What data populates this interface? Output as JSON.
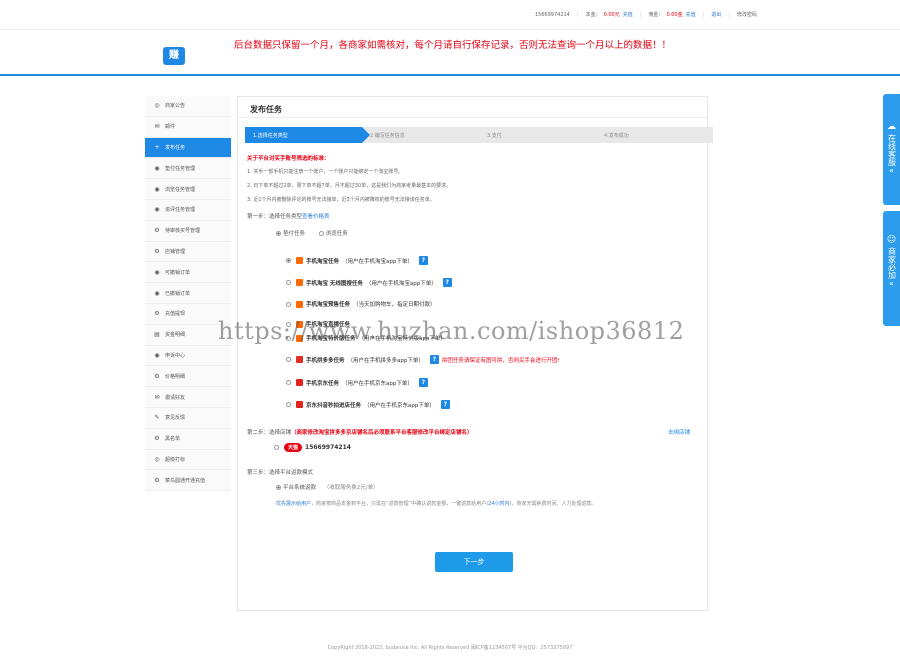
{
  "topbar": {
    "user": "15669974214",
    "capital_label": "本金：",
    "capital_value": "0.00元",
    "recharge": "充值",
    "commission_label": "佣金：",
    "commission_value": "0.00金",
    "recharge2": "充值",
    "logout": "退出",
    "change_password": "修改密码"
  },
  "header": {
    "logo_text": "赚",
    "notice": "后台数据只保留一个月，各商家如需核对，每个月请自行保存记录，否则无法查询一个月以上的数据！！"
  },
  "sidebar": {
    "items": [
      {
        "icon": "◎",
        "label": "商家公告"
      },
      {
        "icon": "✉",
        "label": "邮件"
      },
      {
        "icon": "+",
        "label": "发布任务"
      },
      {
        "icon": "◉",
        "label": "垫付任务管理"
      },
      {
        "icon": "◉",
        "label": "浏览任务管理"
      },
      {
        "icon": "◉",
        "label": "追评任务管理"
      },
      {
        "icon": "⚙",
        "label": "待审核买号管理"
      },
      {
        "icon": "⚙",
        "label": "店铺管理"
      },
      {
        "icon": "◉",
        "label": "可撤销订单"
      },
      {
        "icon": "◉",
        "label": "已撤销订单"
      },
      {
        "icon": "⚙",
        "label": "充值提现"
      },
      {
        "icon": "▤",
        "label": "资金明细"
      },
      {
        "icon": "◉",
        "label": "申诉中心"
      },
      {
        "icon": "⚙",
        "label": "价格明细"
      },
      {
        "icon": "✉",
        "label": "邀请好友"
      },
      {
        "icon": "✎",
        "label": "意见反馈"
      },
      {
        "icon": "⚙",
        "label": "黑名单"
      },
      {
        "icon": "◎",
        "label": "超级打标"
      },
      {
        "icon": "⚙",
        "label": "菜鸟圆通开通充值"
      }
    ]
  },
  "main": {
    "title": "发布任务",
    "steps": [
      "1.选择任务类型",
      "2.编写任务信息",
      "3.支付",
      "4.发布成功"
    ],
    "rules_title": "关于平台对买手账号筛选的标准：",
    "rules": [
      "1. 买手一部手机只能注册一个账户，一个账户只能绑定一个淘宝账号。",
      "2. 日下单不超过2单，周下单不超7单，月不超过30单，这是我们为商家考量最基本的要求。",
      "3. 近1个月内被删除评论的账号无法接单，近3个月内被降权的账号无法接该任务单。"
    ],
    "step1_label": "第一步：选择任务类型",
    "step1_link": "查看价格表",
    "task_types": [
      "垫付任务",
      "浏览任务"
    ],
    "tasks": [
      {
        "name": "手机淘宝任务",
        "desc": "（用户在手机淘宝app下单）",
        "platform": "tb"
      },
      {
        "name": "手机淘宝 无线图搜任务",
        "desc": "（用户在手机淘宝app下单）",
        "platform": "tb"
      },
      {
        "name": "手机淘宝预售任务",
        "desc": "（当天加购物车，指定日期付款）",
        "platform": "tb"
      },
      {
        "name": "手机淘宝直播任务",
        "desc": "",
        "platform": "tb"
      },
      {
        "name": "手机淘宝特价版任务",
        "desc": "（用户在手机淘宝特价版app下单）",
        "platform": "tb"
      },
      {
        "name": "手机拼多多任务",
        "desc": "（用户在手机拼多多app下单）",
        "platform": "pdd",
        "warn": "拼团任务请保证有图可拼，否则买手会进行开团!"
      },
      {
        "name": "手机京东任务",
        "desc": "（用户在手机京东app下单）",
        "platform": "jd"
      },
      {
        "name": "京东抖音秒拍进店任务",
        "desc": "（用户在手机京东app下单）",
        "platform": "jd"
      }
    ],
    "step2_label": "第二步：选择店铺",
    "step2_warn": "（商家修改淘宝拼多多京店铺名后必须联系平台客服修改平台绑定店铺名）",
    "step2_link": "去绑店铺",
    "shop_tag": "天猫",
    "shop_name": "15669974214",
    "step3_label": "第三步：选择平台返款模式",
    "platform_refund": "平台系统返款",
    "platform_refund_fee": "（收取服务费2元/单）",
    "platform_note_prefix": "优先展示给用户",
    "platform_note": "，商家按商品本金到平台，只需在“返款管理”中确认返款金额，一键返款给用户(",
    "platform_note_time": "24小时内",
    "platform_note_suffix": ")，商家无需耗费时间、人力处理返款。",
    "next_button": "下一步"
  },
  "float": {
    "online_service": "在线客服",
    "must_add": "商家必加"
  },
  "watermark": "https://www.huzhan.com/ishop36812",
  "footer": "CopyRight 2018-2022, budanxia Inc. All Rights Reserved 闽ICP备1234567号 平台QQ：2573375997"
}
